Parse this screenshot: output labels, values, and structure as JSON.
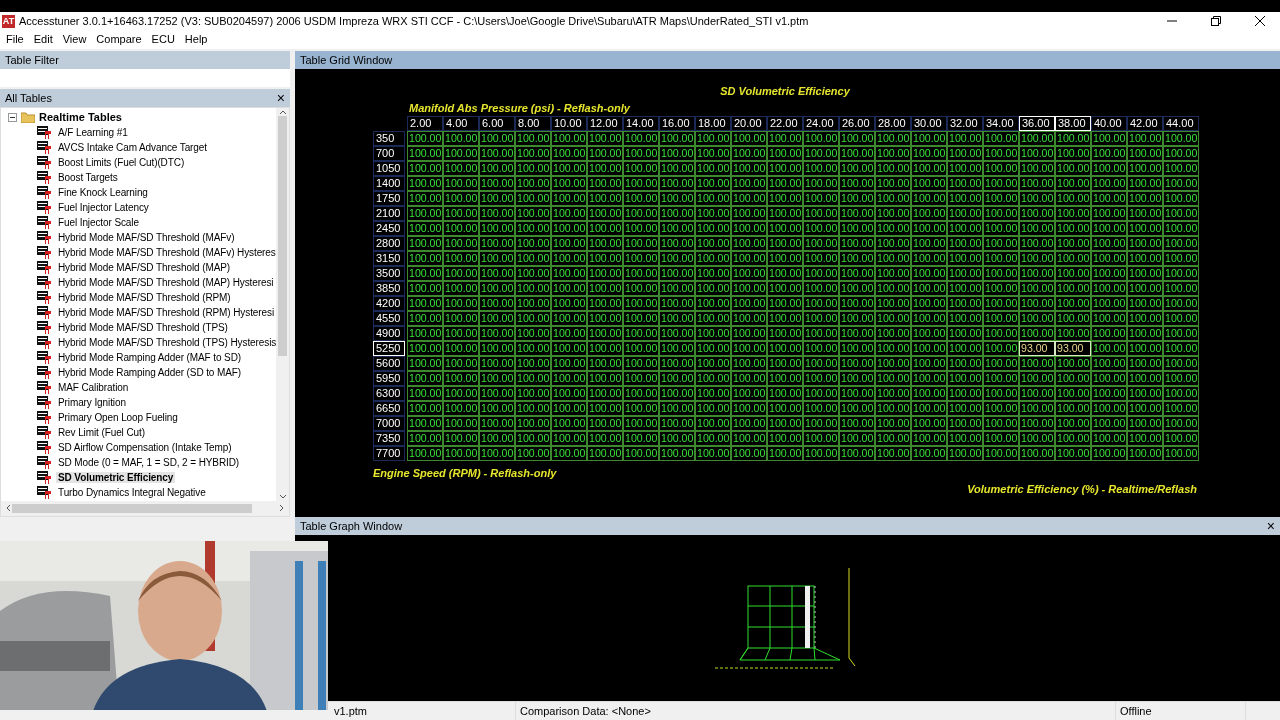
{
  "window": {
    "app_icon": "AT",
    "title": "Accesstuner 3.0.1+16463.17252 (V3: SUB0204597) 2006 USDM Impreza WRX STI CCF - C:\\Users\\Joe\\Google Drive\\Subaru\\ATR Maps\\UnderRated_STI v1.ptm"
  },
  "menu": [
    "File",
    "Edit",
    "View",
    "Compare",
    "ECU",
    "Help"
  ],
  "table_filter": {
    "title": "Table Filter"
  },
  "all_tables": {
    "title": "All Tables",
    "close": "×",
    "tree": [
      {
        "label": "Realtime Tables",
        "expanded": true,
        "children": [
          {
            "label": "A/F Learning #1",
            "selected": false
          },
          {
            "label": "AVCS Intake Cam Advance Target",
            "selected": false
          },
          {
            "label": "Boost Limits (Fuel Cut)(DTC)",
            "selected": false
          },
          {
            "label": "Boost Targets",
            "selected": false
          },
          {
            "label": "Fine Knock Learning",
            "selected": false
          },
          {
            "label": "Fuel Injector Latency",
            "selected": false
          },
          {
            "label": "Fuel Injector Scale",
            "selected": false
          },
          {
            "label": "Hybrid Mode MAF/SD Threshold (MAFv)",
            "selected": false
          },
          {
            "label": "Hybrid Mode MAF/SD Threshold (MAFv) Hysteres",
            "selected": false
          },
          {
            "label": "Hybrid Mode MAF/SD Threshold (MAP)",
            "selected": false
          },
          {
            "label": "Hybrid Mode MAF/SD Threshold (MAP) Hysteresi",
            "selected": false
          },
          {
            "label": "Hybrid Mode MAF/SD Threshold (RPM)",
            "selected": false
          },
          {
            "label": "Hybrid Mode MAF/SD Threshold (RPM) Hysteresi",
            "selected": false
          },
          {
            "label": "Hybrid Mode MAF/SD Threshold (TPS)",
            "selected": false
          },
          {
            "label": "Hybrid Mode MAF/SD Threshold (TPS) Hysteresis",
            "selected": false
          },
          {
            "label": "Hybrid Mode Ramping Adder (MAF to SD)",
            "selected": false
          },
          {
            "label": "Hybrid Mode Ramping Adder (SD to MAF)",
            "selected": false
          },
          {
            "label": "MAF Calibration",
            "selected": false
          },
          {
            "label": "Primary Ignition",
            "selected": false
          },
          {
            "label": "Primary Open Loop Fueling",
            "selected": false
          },
          {
            "label": "Rev Limit (Fuel Cut)",
            "selected": false
          },
          {
            "label": "SD Airflow Compensation (Intake Temp)",
            "selected": false
          },
          {
            "label": "SD Mode (0 = MAF, 1 = SD, 2 = HYBRID)",
            "selected": false
          },
          {
            "label": "SD Volumetric Efficiency",
            "selected": true
          },
          {
            "label": "Turbo Dynamics Integral Negative",
            "selected": false
          }
        ]
      }
    ]
  },
  "grid_window": {
    "title": "Table Grid Window",
    "table_title": "SD Volumetric Efficiency",
    "x_axis_label": "Manifold Abs Pressure (psi) - Reflash-only",
    "y_axis_label": "Engine Speed (RPM) - Reflash-only",
    "value_label": "Volumetric Efficiency (%) - Realtime/Reflash",
    "columns": [
      {
        "label": "2.00",
        "selected": false
      },
      {
        "label": "4.00",
        "selected": false
      },
      {
        "label": "6.00",
        "selected": false
      },
      {
        "label": "8.00",
        "selected": false
      },
      {
        "label": "10.00",
        "selected": false
      },
      {
        "label": "12.00",
        "selected": false
      },
      {
        "label": "14.00",
        "selected": false
      },
      {
        "label": "16.00",
        "selected": false
      },
      {
        "label": "18.00",
        "selected": false
      },
      {
        "label": "20.00",
        "selected": false
      },
      {
        "label": "22.00",
        "selected": false
      },
      {
        "label": "24.00",
        "selected": false
      },
      {
        "label": "26.00",
        "selected": false
      },
      {
        "label": "28.00",
        "selected": false
      },
      {
        "label": "30.00",
        "selected": false
      },
      {
        "label": "32.00",
        "selected": false
      },
      {
        "label": "34.00",
        "selected": false
      },
      {
        "label": "36.00",
        "selected": true
      },
      {
        "label": "38.00",
        "selected": true
      },
      {
        "label": "40.00",
        "selected": false
      },
      {
        "label": "42.00",
        "selected": false
      },
      {
        "label": "44.00",
        "selected": false
      }
    ],
    "rows": [
      {
        "label": "350",
        "selected": false,
        "values": [
          "100.00",
          "100.00",
          "100.00",
          "100.00",
          "100.00",
          "100.00",
          "100.00",
          "100.00",
          "100.00",
          "100.00",
          "100.00",
          "100.00",
          "100.00",
          "100.00",
          "100.00",
          "100.00",
          "100.00",
          "100.00",
          "100.00",
          "100.00",
          "100.00",
          "100.00"
        ]
      },
      {
        "label": "700",
        "selected": false,
        "values": [
          "100.00",
          "100.00",
          "100.00",
          "100.00",
          "100.00",
          "100.00",
          "100.00",
          "100.00",
          "100.00",
          "100.00",
          "100.00",
          "100.00",
          "100.00",
          "100.00",
          "100.00",
          "100.00",
          "100.00",
          "100.00",
          "100.00",
          "100.00",
          "100.00",
          "100.00"
        ]
      },
      {
        "label": "1050",
        "selected": false,
        "values": [
          "100.00",
          "100.00",
          "100.00",
          "100.00",
          "100.00",
          "100.00",
          "100.00",
          "100.00",
          "100.00",
          "100.00",
          "100.00",
          "100.00",
          "100.00",
          "100.00",
          "100.00",
          "100.00",
          "100.00",
          "100.00",
          "100.00",
          "100.00",
          "100.00",
          "100.00"
        ]
      },
      {
        "label": "1400",
        "selected": false,
        "values": [
          "100.00",
          "100.00",
          "100.00",
          "100.00",
          "100.00",
          "100.00",
          "100.00",
          "100.00",
          "100.00",
          "100.00",
          "100.00",
          "100.00",
          "100.00",
          "100.00",
          "100.00",
          "100.00",
          "100.00",
          "100.00",
          "100.00",
          "100.00",
          "100.00",
          "100.00"
        ]
      },
      {
        "label": "1750",
        "selected": false,
        "values": [
          "100.00",
          "100.00",
          "100.00",
          "100.00",
          "100.00",
          "100.00",
          "100.00",
          "100.00",
          "100.00",
          "100.00",
          "100.00",
          "100.00",
          "100.00",
          "100.00",
          "100.00",
          "100.00",
          "100.00",
          "100.00",
          "100.00",
          "100.00",
          "100.00",
          "100.00"
        ]
      },
      {
        "label": "2100",
        "selected": false,
        "values": [
          "100.00",
          "100.00",
          "100.00",
          "100.00",
          "100.00",
          "100.00",
          "100.00",
          "100.00",
          "100.00",
          "100.00",
          "100.00",
          "100.00",
          "100.00",
          "100.00",
          "100.00",
          "100.00",
          "100.00",
          "100.00",
          "100.00",
          "100.00",
          "100.00",
          "100.00"
        ]
      },
      {
        "label": "2450",
        "selected": false,
        "values": [
          "100.00",
          "100.00",
          "100.00",
          "100.00",
          "100.00",
          "100.00",
          "100.00",
          "100.00",
          "100.00",
          "100.00",
          "100.00",
          "100.00",
          "100.00",
          "100.00",
          "100.00",
          "100.00",
          "100.00",
          "100.00",
          "100.00",
          "100.00",
          "100.00",
          "100.00"
        ]
      },
      {
        "label": "2800",
        "selected": false,
        "values": [
          "100.00",
          "100.00",
          "100.00",
          "100.00",
          "100.00",
          "100.00",
          "100.00",
          "100.00",
          "100.00",
          "100.00",
          "100.00",
          "100.00",
          "100.00",
          "100.00",
          "100.00",
          "100.00",
          "100.00",
          "100.00",
          "100.00",
          "100.00",
          "100.00",
          "100.00"
        ]
      },
      {
        "label": "3150",
        "selected": false,
        "values": [
          "100.00",
          "100.00",
          "100.00",
          "100.00",
          "100.00",
          "100.00",
          "100.00",
          "100.00",
          "100.00",
          "100.00",
          "100.00",
          "100.00",
          "100.00",
          "100.00",
          "100.00",
          "100.00",
          "100.00",
          "100.00",
          "100.00",
          "100.00",
          "100.00",
          "100.00"
        ]
      },
      {
        "label": "3500",
        "selected": false,
        "values": [
          "100.00",
          "100.00",
          "100.00",
          "100.00",
          "100.00",
          "100.00",
          "100.00",
          "100.00",
          "100.00",
          "100.00",
          "100.00",
          "100.00",
          "100.00",
          "100.00",
          "100.00",
          "100.00",
          "100.00",
          "100.00",
          "100.00",
          "100.00",
          "100.00",
          "100.00"
        ]
      },
      {
        "label": "3850",
        "selected": false,
        "values": [
          "100.00",
          "100.00",
          "100.00",
          "100.00",
          "100.00",
          "100.00",
          "100.00",
          "100.00",
          "100.00",
          "100.00",
          "100.00",
          "100.00",
          "100.00",
          "100.00",
          "100.00",
          "100.00",
          "100.00",
          "100.00",
          "100.00",
          "100.00",
          "100.00",
          "100.00"
        ]
      },
      {
        "label": "4200",
        "selected": false,
        "values": [
          "100.00",
          "100.00",
          "100.00",
          "100.00",
          "100.00",
          "100.00",
          "100.00",
          "100.00",
          "100.00",
          "100.00",
          "100.00",
          "100.00",
          "100.00",
          "100.00",
          "100.00",
          "100.00",
          "100.00",
          "100.00",
          "100.00",
          "100.00",
          "100.00",
          "100.00"
        ]
      },
      {
        "label": "4550",
        "selected": false,
        "values": [
          "100.00",
          "100.00",
          "100.00",
          "100.00",
          "100.00",
          "100.00",
          "100.00",
          "100.00",
          "100.00",
          "100.00",
          "100.00",
          "100.00",
          "100.00",
          "100.00",
          "100.00",
          "100.00",
          "100.00",
          "100.00",
          "100.00",
          "100.00",
          "100.00",
          "100.00"
        ]
      },
      {
        "label": "4900",
        "selected": false,
        "values": [
          "100.00",
          "100.00",
          "100.00",
          "100.00",
          "100.00",
          "100.00",
          "100.00",
          "100.00",
          "100.00",
          "100.00",
          "100.00",
          "100.00",
          "100.00",
          "100.00",
          "100.00",
          "100.00",
          "100.00",
          "100.00",
          "100.00",
          "100.00",
          "100.00",
          "100.00"
        ]
      },
      {
        "label": "5250",
        "selected": true,
        "values": [
          "100.00",
          "100.00",
          "100.00",
          "100.00",
          "100.00",
          "100.00",
          "100.00",
          "100.00",
          "100.00",
          "100.00",
          "100.00",
          "100.00",
          "100.00",
          "100.00",
          "100.00",
          "100.00",
          "100.00",
          "93.00",
          "93.00",
          "100.00",
          "100.00",
          "100.00"
        ]
      },
      {
        "label": "5600",
        "selected": false,
        "values": [
          "100.00",
          "100.00",
          "100.00",
          "100.00",
          "100.00",
          "100.00",
          "100.00",
          "100.00",
          "100.00",
          "100.00",
          "100.00",
          "100.00",
          "100.00",
          "100.00",
          "100.00",
          "100.00",
          "100.00",
          "100.00",
          "100.00",
          "100.00",
          "100.00",
          "100.00"
        ]
      },
      {
        "label": "5950",
        "selected": false,
        "values": [
          "100.00",
          "100.00",
          "100.00",
          "100.00",
          "100.00",
          "100.00",
          "100.00",
          "100.00",
          "100.00",
          "100.00",
          "100.00",
          "100.00",
          "100.00",
          "100.00",
          "100.00",
          "100.00",
          "100.00",
          "100.00",
          "100.00",
          "100.00",
          "100.00",
          "100.00"
        ]
      },
      {
        "label": "6300",
        "selected": false,
        "values": [
          "100.00",
          "100.00",
          "100.00",
          "100.00",
          "100.00",
          "100.00",
          "100.00",
          "100.00",
          "100.00",
          "100.00",
          "100.00",
          "100.00",
          "100.00",
          "100.00",
          "100.00",
          "100.00",
          "100.00",
          "100.00",
          "100.00",
          "100.00",
          "100.00",
          "100.00"
        ]
      },
      {
        "label": "6650",
        "selected": false,
        "values": [
          "100.00",
          "100.00",
          "100.00",
          "100.00",
          "100.00",
          "100.00",
          "100.00",
          "100.00",
          "100.00",
          "100.00",
          "100.00",
          "100.00",
          "100.00",
          "100.00",
          "100.00",
          "100.00",
          "100.00",
          "100.00",
          "100.00",
          "100.00",
          "100.00",
          "100.00"
        ]
      },
      {
        "label": "7000",
        "selected": false,
        "values": [
          "100.00",
          "100.00",
          "100.00",
          "100.00",
          "100.00",
          "100.00",
          "100.00",
          "100.00",
          "100.00",
          "100.00",
          "100.00",
          "100.00",
          "100.00",
          "100.00",
          "100.00",
          "100.00",
          "100.00",
          "100.00",
          "100.00",
          "100.00",
          "100.00",
          "100.00"
        ]
      },
      {
        "label": "7350",
        "selected": false,
        "values": [
          "100.00",
          "100.00",
          "100.00",
          "100.00",
          "100.00",
          "100.00",
          "100.00",
          "100.00",
          "100.00",
          "100.00",
          "100.00",
          "100.00",
          "100.00",
          "100.00",
          "100.00",
          "100.00",
          "100.00",
          "100.00",
          "100.00",
          "100.00",
          "100.00",
          "100.00"
        ]
      },
      {
        "label": "7700",
        "selected": false,
        "values": [
          "100.00",
          "100.00",
          "100.00",
          "100.00",
          "100.00",
          "100.00",
          "100.00",
          "100.00",
          "100.00",
          "100.00",
          "100.00",
          "100.00",
          "100.00",
          "100.00",
          "100.00",
          "100.00",
          "100.00",
          "100.00",
          "100.00",
          "100.00",
          "100.00",
          "100.00"
        ]
      }
    ]
  },
  "graph_window": {
    "title": "Table Graph Window",
    "close": "×"
  },
  "status_bar": [
    "v1.ptm",
    "Comparison Data: <None>",
    "Offline"
  ]
}
